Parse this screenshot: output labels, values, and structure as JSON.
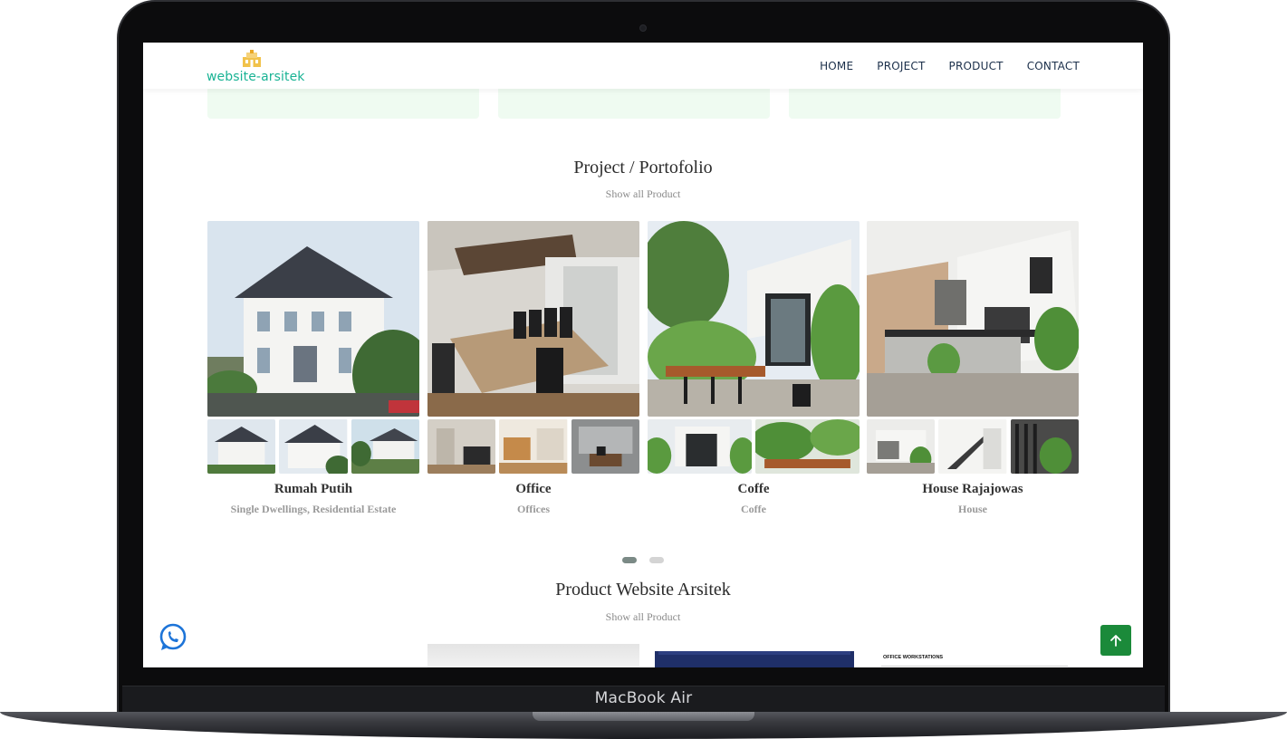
{
  "device": {
    "label": "MacBook Air"
  },
  "navbar": {
    "logo_text": "website-arsitek",
    "links": [
      "HOME",
      "PROJECT",
      "PRODUCT",
      "CONTACT"
    ]
  },
  "projects_section": {
    "title": "Project / Portofolio",
    "link": "Show all Product",
    "cards": [
      {
        "name": "Rumah Putih",
        "category": "Single Dwellings, Residential Estate"
      },
      {
        "name": "Office",
        "category": "Offices"
      },
      {
        "name": "Coffe",
        "category": "Coffe"
      },
      {
        "name": "House Rajajowas",
        "category": "House"
      }
    ],
    "carousel": {
      "pages": 2,
      "active_page": 1
    }
  },
  "products_section": {
    "title": "Product Website Arsitek",
    "link": "Show all Product",
    "peek_label": "OFFICE WORKSTATIONS"
  },
  "colors": {
    "brand": "#19b394",
    "nav_text": "#1b2f4a",
    "card_stub": "#effbf1",
    "scroll_top": "#1b8a3a",
    "whatsapp": "#1d74d8"
  },
  "icons": [
    "whatsapp-icon",
    "arrow-up-icon",
    "logo-building-icon"
  ]
}
